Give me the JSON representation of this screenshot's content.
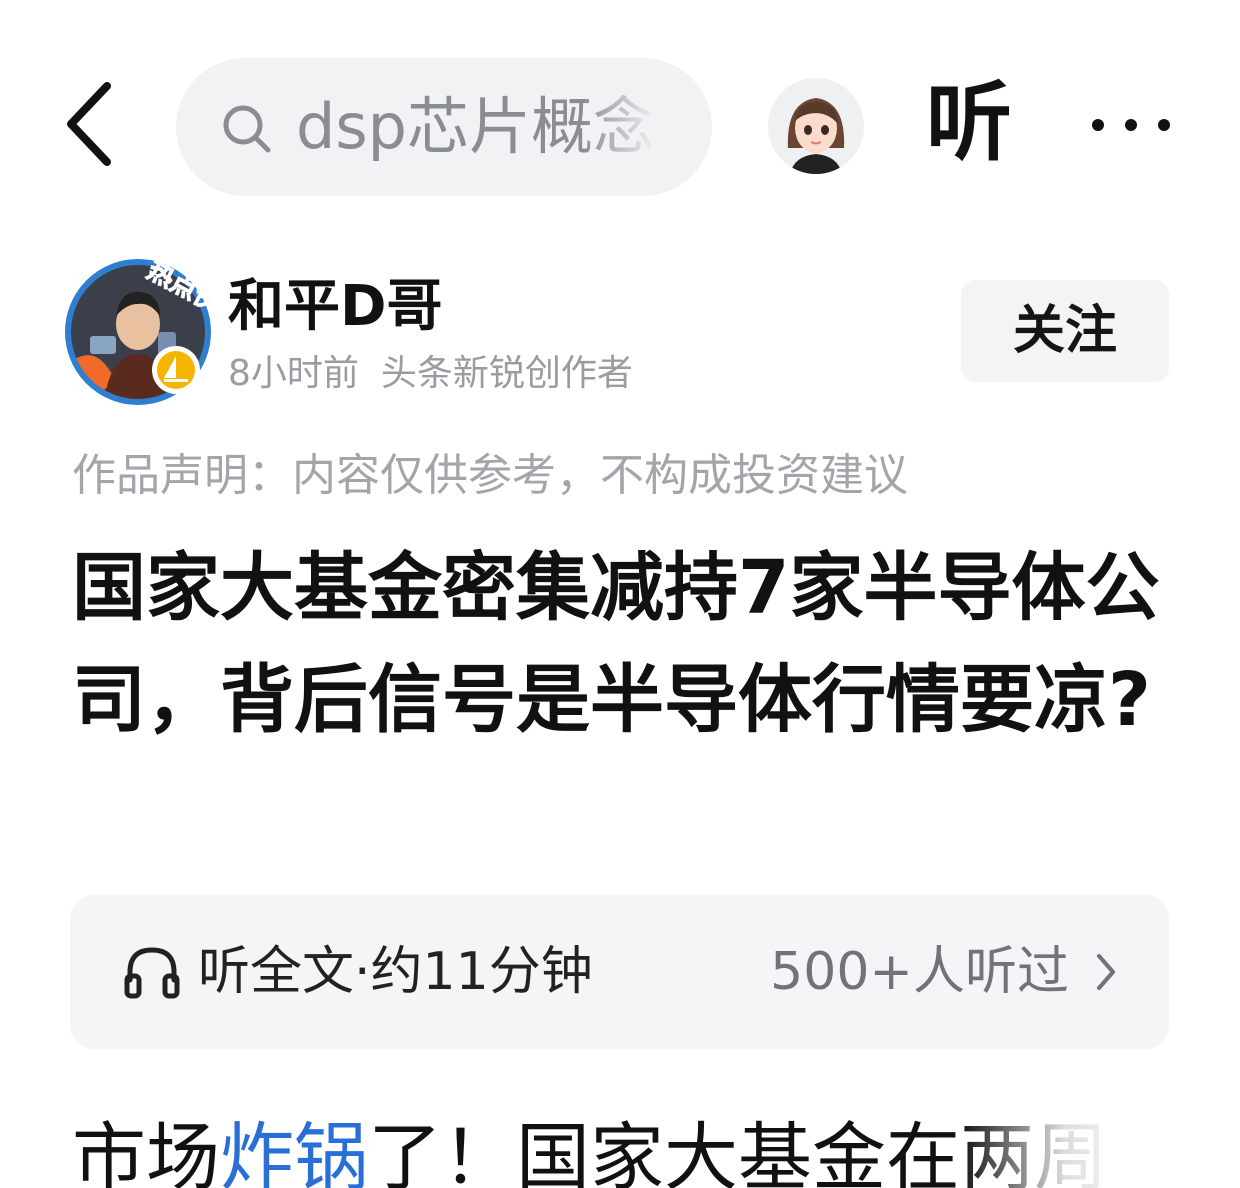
{
  "topbar": {
    "search_text": "dsp芯片概念",
    "listen_label": "听"
  },
  "author": {
    "name": "和平D哥",
    "time_ago": "8小时前",
    "badge_text": "头条新锐创作者",
    "avatar_badge": "热点侠",
    "follow_label": "关注"
  },
  "article": {
    "disclaimer": "作品声明：内容仅供参考，不构成投资建议",
    "title": "国家大基金密集减持7家半导体公司，背后信号是半导体行情要凉?",
    "body_prefix": "市场",
    "body_link": "炸锅",
    "body_suffix": "了！国家大基金在两周"
  },
  "listen_card": {
    "label": "听全文·约11分钟",
    "count": "500+人听过"
  },
  "colors": {
    "link": "#2a6fd6",
    "muted_text": "#9a9ca1",
    "card_bg": "#f4f5f6",
    "search_bg": "#f1f2f4"
  },
  "icons": {
    "back": "chevron-left-icon",
    "search": "search-icon",
    "more": "more-horizontal-icon",
    "headphones": "headphones-icon",
    "chevron": "chevron-right-icon"
  }
}
